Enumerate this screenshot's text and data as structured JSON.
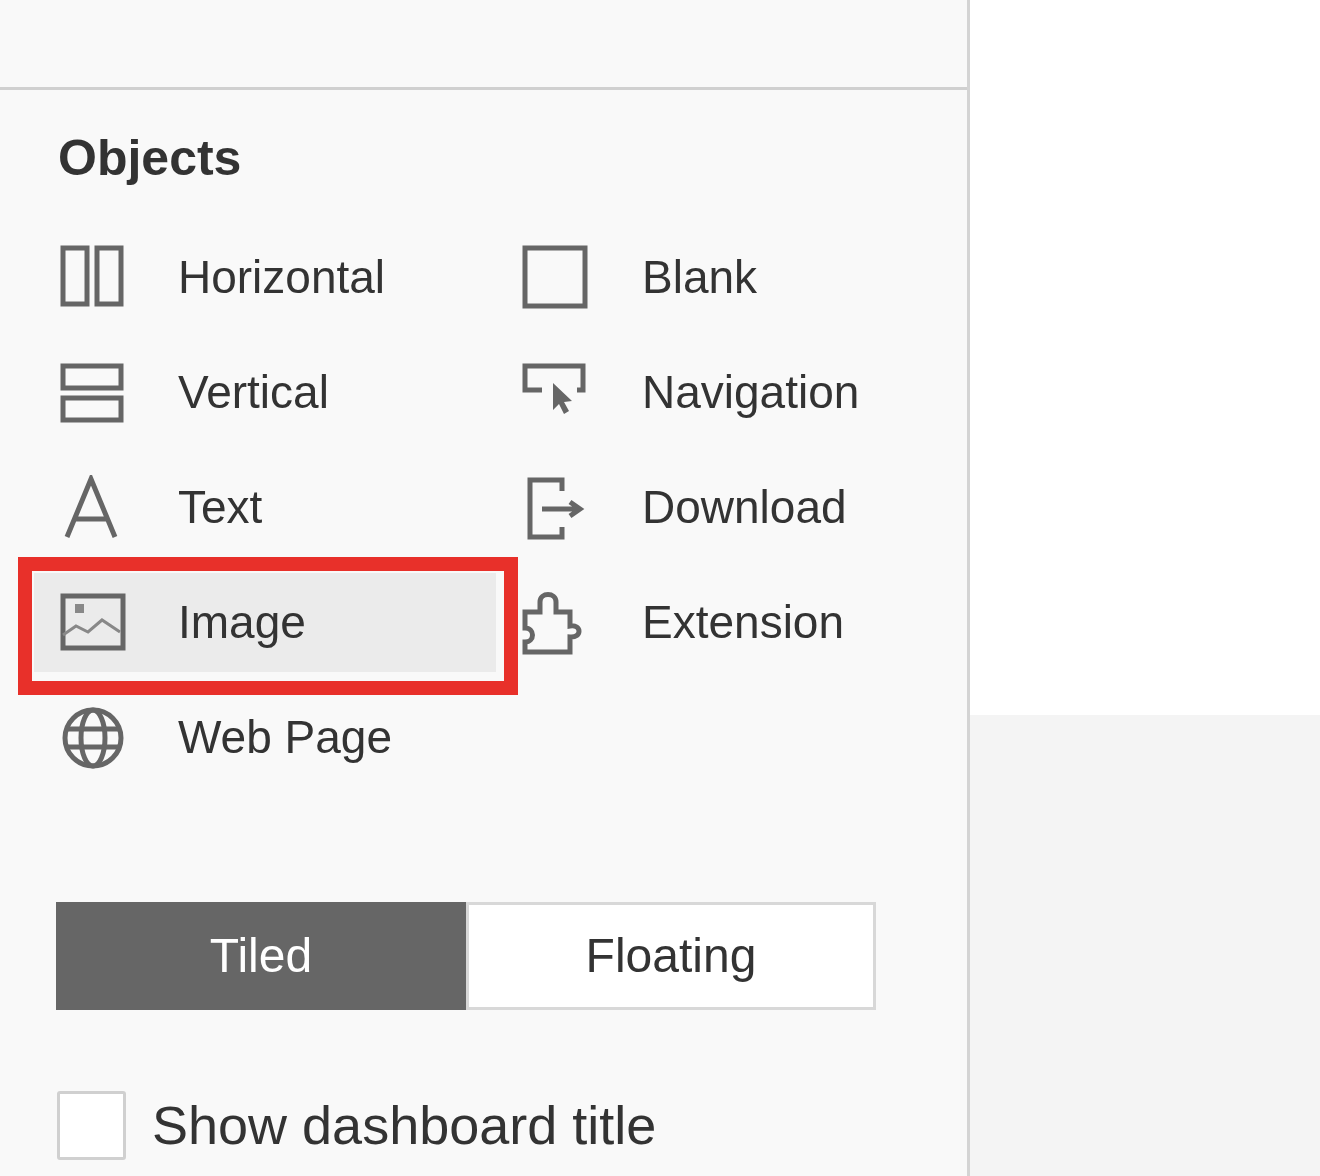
{
  "objects_panel": {
    "title": "Objects",
    "items": [
      {
        "kind": "horizontal",
        "label": "Horizontal",
        "selected": false,
        "callout": false
      },
      {
        "kind": "blank",
        "label": "Blank",
        "selected": false,
        "callout": false
      },
      {
        "kind": "vertical",
        "label": "Vertical",
        "selected": false,
        "callout": false
      },
      {
        "kind": "navigation",
        "label": "Navigation",
        "selected": false,
        "callout": false
      },
      {
        "kind": "text",
        "label": "Text",
        "selected": false,
        "callout": false
      },
      {
        "kind": "download",
        "label": "Download",
        "selected": false,
        "callout": false
      },
      {
        "kind": "image",
        "label": "Image",
        "selected": true,
        "callout": true
      },
      {
        "kind": "extension",
        "label": "Extension",
        "selected": false,
        "callout": false
      },
      {
        "kind": "webpage",
        "label": "Web Page",
        "selected": false,
        "callout": false
      }
    ],
    "layout_toggle": [
      {
        "label": "Tiled",
        "selected": true
      },
      {
        "label": "Floating",
        "selected": false
      }
    ],
    "show_title": {
      "label": "Show dashboard title",
      "checked": false
    }
  }
}
